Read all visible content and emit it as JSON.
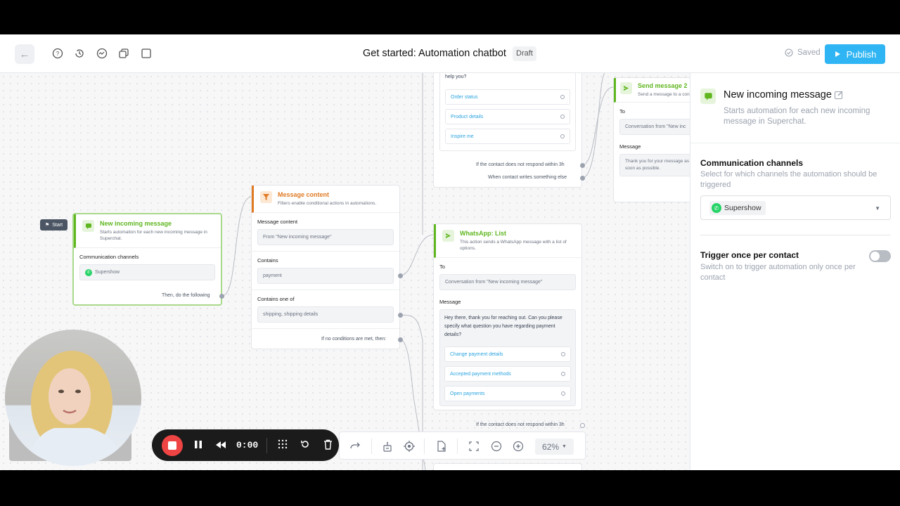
{
  "header": {
    "back_icon": "←",
    "title": "Get started: Automation chatbot",
    "status_badge": "Draft",
    "saved_label": "Saved",
    "publish_label": "Publish"
  },
  "canvas": {
    "start_tag": "Start",
    "node_incoming": {
      "title": "New incoming message",
      "description": "Starts automation for each new incoming message in Superchat.",
      "section_label": "Communication channels",
      "channel": "Supershow",
      "footer": "Then, do the following"
    },
    "node_filter": {
      "title": "Message content",
      "description": "Filters enable conditional actions in automations.",
      "s1_label": "Message content",
      "s1_value": "From \"New incoming message\"",
      "s2_label": "Contains",
      "s2_value": "payment",
      "s3_label": "Contains one of",
      "s3_value": "shipping, shipping details",
      "footer": "If no conditions are met, then:"
    },
    "node_top": {
      "help_text": "help you?",
      "options": [
        "Order status",
        "Product details",
        "Inspire me"
      ],
      "footer1": "If the contact does not respond within 3h",
      "footer2": "When contact writes something else"
    },
    "node_send2": {
      "title": "Send message 2",
      "description": "Send a message to a con",
      "to_label": "To",
      "to_value": "Conversation from \"New inc",
      "msg_label": "Message",
      "msg_value": "Thank you for your message as soon as possible."
    },
    "node_list": {
      "title": "WhatsApp: List",
      "description": "This action sends a WhatsApp message with a list of options.",
      "to_label": "To",
      "to_value": "Conversation from \"New incoming message\"",
      "msg_label": "Message",
      "msg_value": "Hey there, thank you for reaching out. Can you please specify what question you have regarding payment details?",
      "options": [
        "Change payment details",
        "Accepted payment methods",
        "Open payments"
      ],
      "footer": "If the contact does not respond within 3h"
    }
  },
  "panel": {
    "title": "New incoming message",
    "description": "Starts automation for each new incoming message in Superchat.",
    "channels_heading": "Communication channels",
    "channels_sub": "Select for which channels the automation should be triggered",
    "channel_chip": "Supershow",
    "trigger_heading": "Trigger once per contact",
    "trigger_sub": "Switch on to trigger automation only once per contact",
    "trigger_on": false
  },
  "recorder": {
    "timer": "0:00"
  },
  "controls": {
    "zoom": "62%"
  },
  "colors": {
    "accent": "#2fb5f3",
    "green": "#5fb61f",
    "orange": "#e07b24",
    "record": "#ef4444"
  }
}
